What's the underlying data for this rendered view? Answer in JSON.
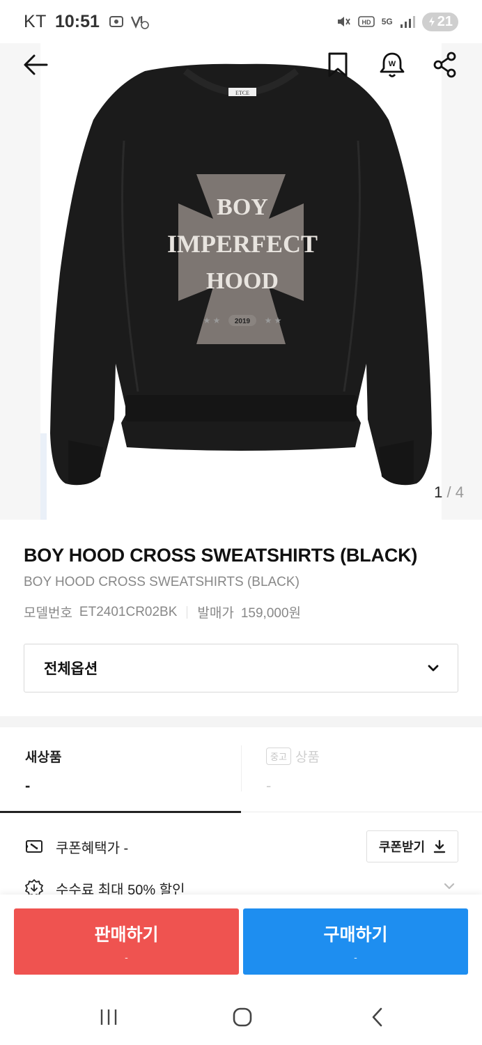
{
  "status_bar": {
    "carrier": "KT",
    "time": "10:51",
    "network": "5G",
    "battery": "21"
  },
  "product": {
    "image_page_current": "1",
    "image_page_separator": "/",
    "image_page_total": "4",
    "print_lines": [
      "BOY",
      "IMPERFECT",
      "HOOD"
    ],
    "print_year": "2019",
    "neck_label": "ETCE",
    "title": "BOY HOOD CROSS SWEATSHIRTS (BLACK)",
    "subtitle": "BOY HOOD CROSS SWEATSHIRTS (BLACK)",
    "model_label": "모델번호",
    "model_value": "ET2401CR02BK",
    "release_price_label": "발매가",
    "release_price_value": "159,000원"
  },
  "option_select": {
    "label": "전체옵션"
  },
  "tabs": [
    {
      "label": "새상품",
      "price": "-",
      "badge": ""
    },
    {
      "label": "상품",
      "price": "-",
      "badge": "중고"
    }
  ],
  "benefits": {
    "coupon_text": "쿠폰혜택가 -",
    "coupon_button": "쿠폰받기",
    "fee_text": "수수료 최대 50% 할인"
  },
  "actions": {
    "sell_label": "판매하기",
    "sell_sub": "-",
    "buy_label": "구매하기",
    "buy_sub": "-",
    "sell_color": "#ef5350",
    "buy_color": "#1e8ef0"
  },
  "icons": {
    "back": "arrow-left-icon",
    "bookmark": "bookmark-icon",
    "alert": "price-alert-bell-icon",
    "share": "share-icon",
    "option_chevron": "chevron-down-icon",
    "coupon": "coupon-icon",
    "download": "download-icon",
    "fee": "discount-badge-icon",
    "fee_chevron": "chevron-down-icon"
  }
}
